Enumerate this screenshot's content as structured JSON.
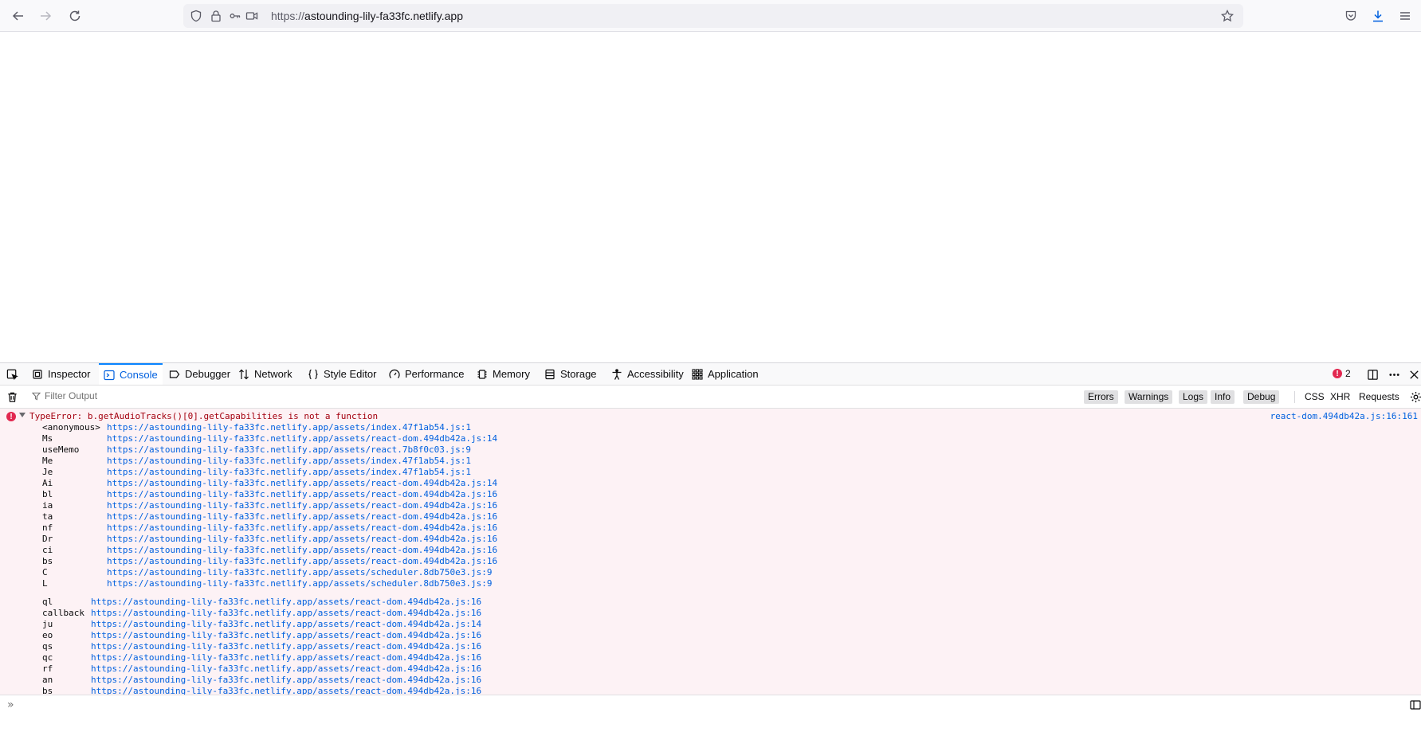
{
  "browser": {
    "url_scheme": "https://",
    "url_host": "astounding-lily-fa33fc.netlify.app",
    "icons": {
      "back": "arrow-left-icon",
      "forward": "arrow-right-icon",
      "reload": "reload-icon",
      "shield": "tracking-shield-icon",
      "lock": "lock-icon",
      "permissions": "permissions-icon",
      "camera": "camera-icon",
      "bookmark": "star-icon",
      "pocket": "pocket-icon",
      "downloads": "download-icon",
      "menu": "hamburger-menu-icon"
    },
    "colors": {
      "download_accent": "#0060df"
    }
  },
  "devtools": {
    "tabs": [
      {
        "label": "Inspector",
        "icon": "inspector-icon"
      },
      {
        "label": "Console",
        "icon": "console-icon",
        "selected": true
      },
      {
        "label": "Debugger",
        "icon": "debugger-icon"
      },
      {
        "label": "Network",
        "icon": "network-icon"
      },
      {
        "label": "Style Editor",
        "icon": "braces-icon"
      },
      {
        "label": "Performance",
        "icon": "gauge-icon"
      },
      {
        "label": "Memory",
        "icon": "chip-icon"
      },
      {
        "label": "Storage",
        "icon": "storage-icon"
      },
      {
        "label": "Accessibility",
        "icon": "accessibility-icon"
      },
      {
        "label": "Application",
        "icon": "grid-icon"
      }
    ],
    "error_count": "2",
    "filter": {
      "placeholder": "Filter Output",
      "levels": [
        {
          "label": "Errors",
          "on": true
        },
        {
          "label": "Warnings",
          "on": true
        },
        {
          "label": "Logs",
          "on": true
        },
        {
          "label": "Info",
          "on": true
        },
        {
          "label": "Debug",
          "on": true
        }
      ],
      "types": [
        "CSS",
        "XHR",
        "Requests"
      ]
    },
    "error": {
      "message": "TypeError: b.getAudioTracks()[0].getCapabilities is not a function",
      "location": "react-dom.494db42a.js:16:161",
      "stack_group_1": [
        {
          "fn": "<anonymous>",
          "src": "https://astounding-lily-fa33fc.netlify.app/assets/index.47f1ab54.js:1"
        },
        {
          "fn": "Ms",
          "src": "https://astounding-lily-fa33fc.netlify.app/assets/react-dom.494db42a.js:14"
        },
        {
          "fn": "useMemo",
          "src": "https://astounding-lily-fa33fc.netlify.app/assets/react.7b8f0c03.js:9"
        },
        {
          "fn": "Me",
          "src": "https://astounding-lily-fa33fc.netlify.app/assets/index.47f1ab54.js:1"
        },
        {
          "fn": "Je",
          "src": "https://astounding-lily-fa33fc.netlify.app/assets/index.47f1ab54.js:1"
        },
        {
          "fn": "Ai",
          "src": "https://astounding-lily-fa33fc.netlify.app/assets/react-dom.494db42a.js:14"
        },
        {
          "fn": "bl",
          "src": "https://astounding-lily-fa33fc.netlify.app/assets/react-dom.494db42a.js:16"
        },
        {
          "fn": "ia",
          "src": "https://astounding-lily-fa33fc.netlify.app/assets/react-dom.494db42a.js:16"
        },
        {
          "fn": "ta",
          "src": "https://astounding-lily-fa33fc.netlify.app/assets/react-dom.494db42a.js:16"
        },
        {
          "fn": "nf",
          "src": "https://astounding-lily-fa33fc.netlify.app/assets/react-dom.494db42a.js:16"
        },
        {
          "fn": "Dr",
          "src": "https://astounding-lily-fa33fc.netlify.app/assets/react-dom.494db42a.js:16"
        },
        {
          "fn": "ci",
          "src": "https://astounding-lily-fa33fc.netlify.app/assets/react-dom.494db42a.js:16"
        },
        {
          "fn": "bs",
          "src": "https://astounding-lily-fa33fc.netlify.app/assets/react-dom.494db42a.js:16"
        },
        {
          "fn": "C",
          "src": "https://astounding-lily-fa33fc.netlify.app/assets/scheduler.8db750e3.js:9"
        },
        {
          "fn": "L",
          "src": "https://astounding-lily-fa33fc.netlify.app/assets/scheduler.8db750e3.js:9"
        }
      ],
      "stack_group_2": [
        {
          "fn": "ql",
          "src": "https://astounding-lily-fa33fc.netlify.app/assets/react-dom.494db42a.js:16"
        },
        {
          "fn": "callback",
          "src": "https://astounding-lily-fa33fc.netlify.app/assets/react-dom.494db42a.js:16"
        },
        {
          "fn": "ju",
          "src": "https://astounding-lily-fa33fc.netlify.app/assets/react-dom.494db42a.js:14"
        },
        {
          "fn": "eo",
          "src": "https://astounding-lily-fa33fc.netlify.app/assets/react-dom.494db42a.js:16"
        },
        {
          "fn": "qs",
          "src": "https://astounding-lily-fa33fc.netlify.app/assets/react-dom.494db42a.js:16"
        },
        {
          "fn": "qc",
          "src": "https://astounding-lily-fa33fc.netlify.app/assets/react-dom.494db42a.js:16"
        },
        {
          "fn": "rf",
          "src": "https://astounding-lily-fa33fc.netlify.app/assets/react-dom.494db42a.js:16"
        },
        {
          "fn": "an",
          "src": "https://astounding-lily-fa33fc.netlify.app/assets/react-dom.494db42a.js:16"
        },
        {
          "fn": "bs",
          "src": "https://astounding-lily-fa33fc.netlify.app/assets/react-dom.494db42a.js:16"
        }
      ]
    },
    "input_prompt": "»",
    "colors": {
      "selected_tab": "#0060df",
      "error_bg": "#fdf2f5",
      "error_text": "#a4000f",
      "error_badge": "#e22850",
      "link": "#0060df"
    }
  }
}
